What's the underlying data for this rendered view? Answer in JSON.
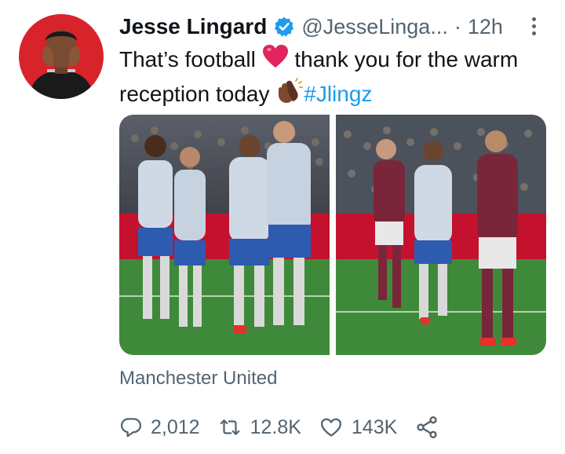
{
  "tweet": {
    "author_name": "Jesse Lingard",
    "handle": "@JesseLinga...",
    "separator": "·",
    "time": "12h",
    "text_part1": "That’s football ",
    "heart_emoji": "red-heart",
    "text_part2": " thank you for the warm reception today ",
    "clap_emoji": "clapping-hands-dark-skin",
    "hashtag": "#Jlingz",
    "location": "Manchester United"
  },
  "actions": {
    "replies": "2,012",
    "retweets": "12.8K",
    "likes": "143K"
  },
  "icons": {
    "verified": "verified-badge-icon",
    "more": "more-vertical-icon",
    "reply": "reply-bubble-icon",
    "retweet": "retweet-icon",
    "like": "heart-outline-icon",
    "share": "share-icon"
  },
  "colors": {
    "accent": "#1d9bf0",
    "text_primary": "#0f1419",
    "text_secondary": "#536471",
    "avatar_background": "#d8232a",
    "pitch_green": "#3f8a3a",
    "west_ham_claret": "#7a263a"
  }
}
